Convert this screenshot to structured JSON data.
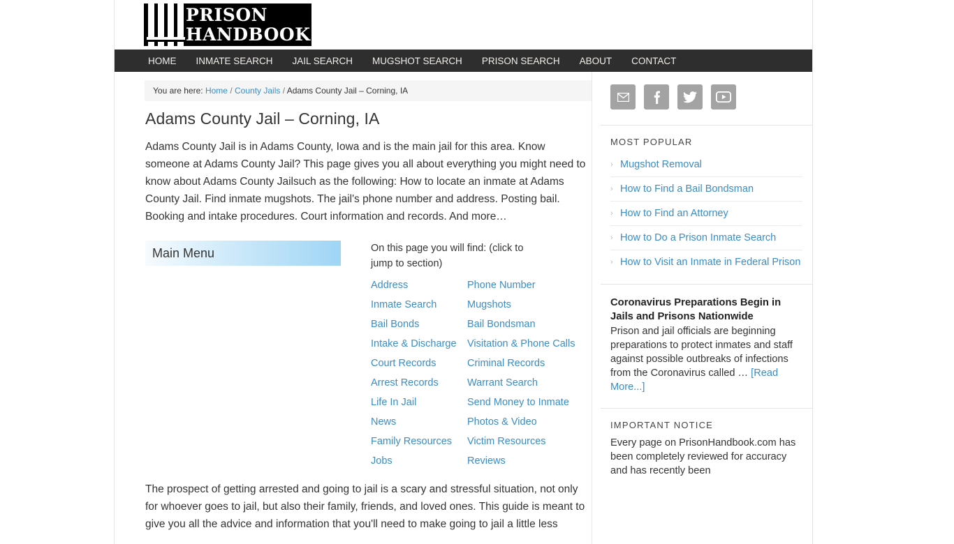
{
  "site": {
    "logo": {
      "line1": "PRISON",
      "line2": "HANDBOOK",
      "bars_icon": "prison-bars-icon"
    }
  },
  "nav": {
    "items": [
      "HOME",
      "INMATE SEARCH",
      "JAIL SEARCH",
      "MUGSHOT SEARCH",
      "PRISON SEARCH",
      "ABOUT",
      "CONTACT"
    ]
  },
  "breadcrumb": {
    "prefix": "You are here:",
    "home": "Home",
    "sep1": "/",
    "parent": "County Jails",
    "sep2": "/",
    "current": "Adams County Jail – Corning, IA"
  },
  "main": {
    "title": "Adams County Jail – Corning, IA",
    "intro": "Adams County Jail is in Adams County, Iowa and is the main jail for this area. Know someone at Adams County Jail? This page gives you all about everything you might need to know about Adams County Jailsuch as the following: How to locate an inmate at Adams County Jail. Find inmate mugshots. The jail's phone number and address. Posting bail. Booking and intake procedures. Court information and records. And more…",
    "main_menu_title": "Main Menu",
    "on_this_page_lead": "On this page you will find: (click to jump to section)",
    "jump_links": [
      {
        "left": "Address",
        "right": "Phone Number"
      },
      {
        "left": "Inmate Search",
        "right": "Mugshots"
      },
      {
        "left": "Bail Bonds",
        "right": "Bail Bondsman"
      },
      {
        "left": "Intake & Discharge",
        "right": "Visitation & Phone Calls"
      },
      {
        "left": "Court Records",
        "right": "Criminal Records"
      },
      {
        "left": "Arrest Records",
        "right": "Warrant Search"
      },
      {
        "left": "Life In Jail",
        "right": "Send Money to Inmate"
      },
      {
        "left": "News",
        "right": "Photos & Video"
      },
      {
        "left": "Family Resources",
        "right": "Victim Resources"
      },
      {
        "left": "Jobs",
        "right": "Reviews"
      }
    ],
    "closing_paragraph": "The prospect of getting arrested and going to jail is a scary and stressful situation, not only for whoever goes to jail, but also their family, friends, and loved ones. This guide is meant to give you all the advice and information that you'll need to make going to jail a little less"
  },
  "sidebar": {
    "social": [
      {
        "name": "email-icon",
        "label": "Email"
      },
      {
        "name": "facebook-icon",
        "label": "Facebook"
      },
      {
        "name": "twitter-icon",
        "label": "Twitter"
      },
      {
        "name": "youtube-icon",
        "label": "YouTube"
      }
    ],
    "most_popular": {
      "title": "Most Popular",
      "items": [
        "Mugshot Removal",
        "How to Find a Bail Bondsman",
        "How to Find an Attorney",
        "How to Do a Prison Inmate Search",
        "How to Visit an Inmate in Federal Prison"
      ]
    },
    "featured_post": {
      "title": "Coronavirus Preparations Begin in Jails and Prisons Nationwide",
      "excerpt": "Prison and jail officials are beginning preparations to protect inmates and staff against possible outbreaks of infections from the Coronavirus called … ",
      "read_more": "[Read More...]"
    },
    "notice": {
      "title": "Important Notice",
      "text": "Every page on PrisonHandbook.com has been completely reviewed for accuracy and has recently been"
    }
  },
  "colors": {
    "link": "#3a8dc4",
    "nav_bg": "#2e2e2e",
    "menu_gradient_end": "#9fd5f5",
    "social_icon_bg": "#a3a3a3"
  }
}
